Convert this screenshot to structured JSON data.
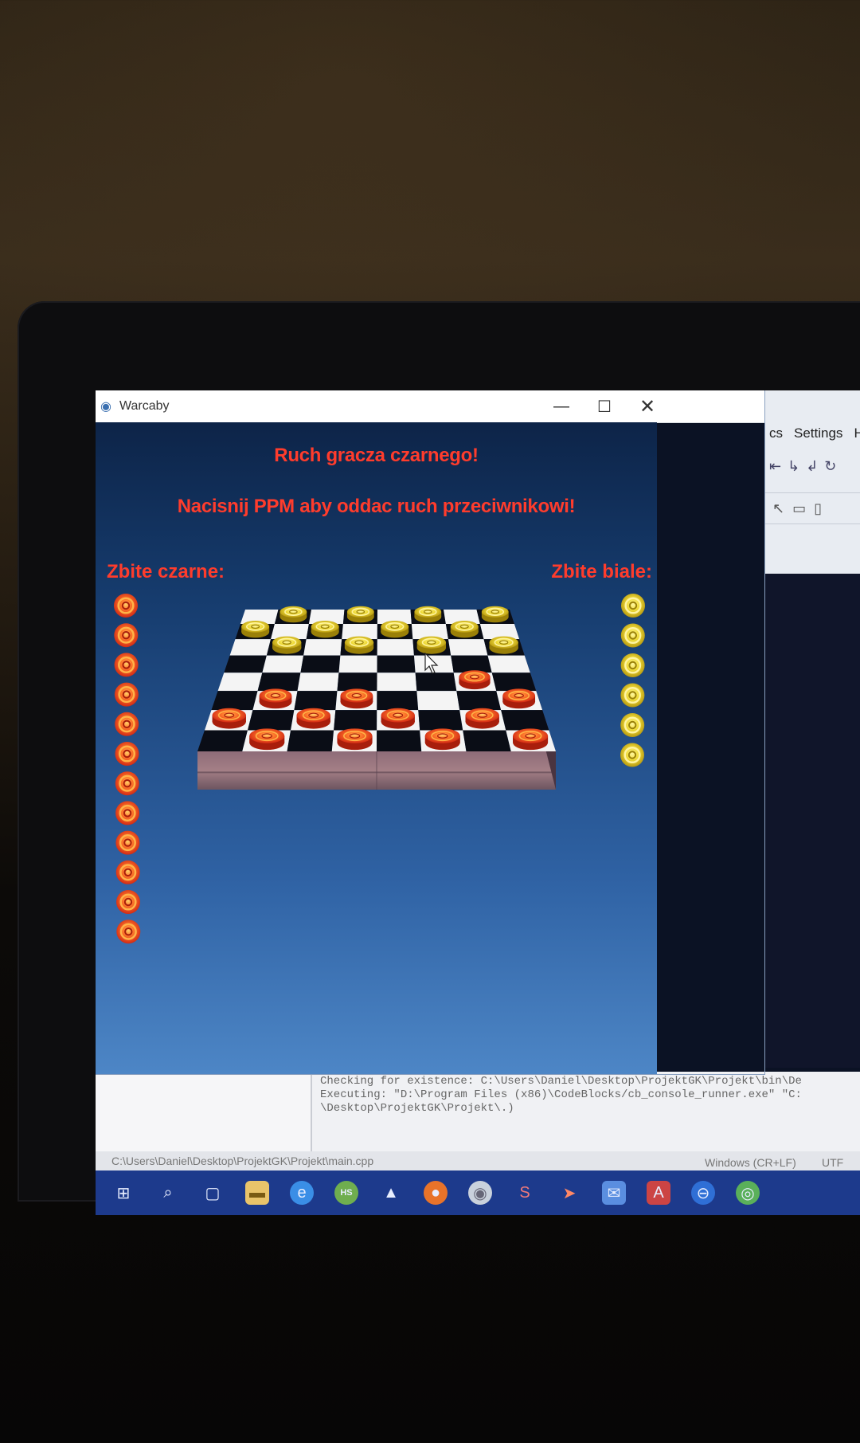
{
  "window": {
    "title": "Warcaby",
    "controls": {
      "minimize": "—",
      "maximize": "☐",
      "close": "✕"
    }
  },
  "game": {
    "turn_message": "Ruch gracza czarnego!",
    "hint_message": "Nacisnij PPM aby oddac ruch przeciwnikowi!",
    "captured_black_label": "Zbite czarne:",
    "captured_white_label": "Zbite biale:",
    "captured_black_count": 12,
    "captured_white_count": 6,
    "board_size": 8,
    "yellow_pieces": [
      [
        0,
        1
      ],
      [
        0,
        3
      ],
      [
        0,
        5
      ],
      [
        0,
        7
      ],
      [
        1,
        0
      ],
      [
        1,
        2
      ],
      [
        1,
        4
      ],
      [
        1,
        6
      ],
      [
        2,
        1
      ],
      [
        2,
        3
      ],
      [
        2,
        5
      ],
      [
        2,
        7
      ]
    ],
    "red_pieces": [
      [
        4,
        6
      ],
      [
        5,
        1
      ],
      [
        5,
        3
      ],
      [
        5,
        7
      ],
      [
        6,
        0
      ],
      [
        6,
        2
      ],
      [
        6,
        4
      ],
      [
        6,
        6
      ],
      [
        7,
        1
      ],
      [
        7,
        3
      ],
      [
        7,
        5
      ],
      [
        7,
        7
      ]
    ],
    "colors": {
      "text": "#ff3c2c",
      "red_piece": "#f04a22",
      "yellow_piece": "#e8d020",
      "dark_square": "#0a0d16",
      "light_square": "#f4f4f4"
    }
  },
  "ide": {
    "menu": [
      "cs",
      "Settings",
      "H"
    ],
    "log_lines": [
      "Checking for existence: C:\\Users\\Daniel\\Desktop\\ProjektGK\\Projekt\\bin\\De",
      "Executing: \"D:\\Program Files (x86)\\CodeBlocks/cb_console_runner.exe\" \"C:",
      "\\Desktop\\ProjektGK\\Projekt\\.)"
    ],
    "status_path": "C:\\Users\\Daniel\\Desktop\\ProjektGK\\Projekt\\main.cpp",
    "status_eol": "Windows (CR+LF)",
    "status_encoding": "UTF"
  },
  "taskbar": {
    "icons": [
      "windows-start-icon",
      "search-icon",
      "task-view-icon",
      "file-explorer-icon",
      "edge-icon",
      "hs-icon",
      "inkscape-icon",
      "firefox-icon",
      "disc-icon",
      "app-s-icon",
      "arrow-app-icon",
      "mail-icon",
      "dictionary-icon",
      "blue-app-icon",
      "chrome-icon"
    ],
    "hs_label": "HS"
  }
}
